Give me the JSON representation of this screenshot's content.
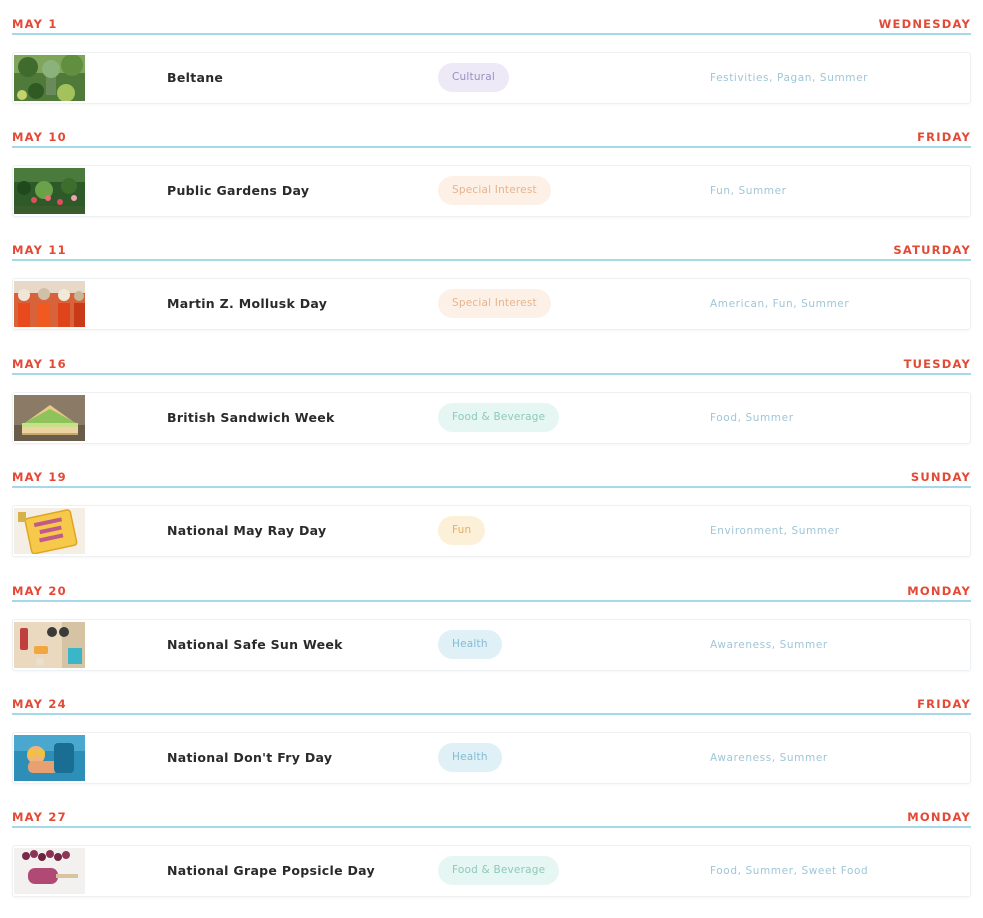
{
  "events": [
    {
      "date": "MAY 1",
      "weekday": "WEDNESDAY",
      "title": "Beltane",
      "category": "Cultural",
      "category_bg": "#ede9f6",
      "category_fg": "#9a90c2",
      "tags": "Festivities, Pagan, Summer",
      "thumb_icon": "green-maypole-image"
    },
    {
      "date": "MAY 10",
      "weekday": "FRIDAY",
      "title": "Public Gardens Day",
      "category": "Special Interest",
      "category_bg": "#fdf1e7",
      "category_fg": "#e7b38e",
      "tags": "Fun, Summer",
      "thumb_icon": "garden-flowers-image"
    },
    {
      "date": "MAY 11",
      "weekday": "SATURDAY",
      "title": "Martin Z. Mollusk Day",
      "category": "Special Interest",
      "category_bg": "#fdf1e7",
      "category_fg": "#e7b38e",
      "tags": "American, Fun, Summer",
      "thumb_icon": "costumed-crowd-image"
    },
    {
      "date": "MAY 16",
      "weekday": "TUESDAY",
      "title": "British Sandwich Week",
      "category": "Food & Beverage",
      "category_bg": "#e6f6f2",
      "category_fg": "#8ccab9",
      "tags": "Food, Summer",
      "thumb_icon": "sandwich-image"
    },
    {
      "date": "MAY 19",
      "weekday": "SUNDAY",
      "title": "National May Ray Day",
      "category": "Fun",
      "category_bg": "#fdf0d8",
      "category_fg": "#dfb168",
      "tags": "Environment, Summer",
      "thumb_icon": "may-ray-day-sign-image"
    },
    {
      "date": "MAY 20",
      "weekday": "MONDAY",
      "title": "National Safe Sun Week",
      "category": "Health",
      "category_bg": "#dff0f7",
      "category_fg": "#82bcd4",
      "tags": "Awareness, Summer",
      "thumb_icon": "beach-items-image"
    },
    {
      "date": "MAY 24",
      "weekday": "FRIDAY",
      "title": "National Don't Fry Day",
      "category": "Health",
      "category_bg": "#dff0f7",
      "category_fg": "#82bcd4",
      "tags": "Awareness, Summer",
      "thumb_icon": "sunbather-image"
    },
    {
      "date": "MAY 27",
      "weekday": "MONDAY",
      "title": "National Grape Popsicle Day",
      "category": "Food & Beverage",
      "category_bg": "#e6f6f2",
      "category_fg": "#8ccab9",
      "tags": "Food, Summer, Sweet Food",
      "thumb_icon": "grape-popsicle-image"
    }
  ]
}
